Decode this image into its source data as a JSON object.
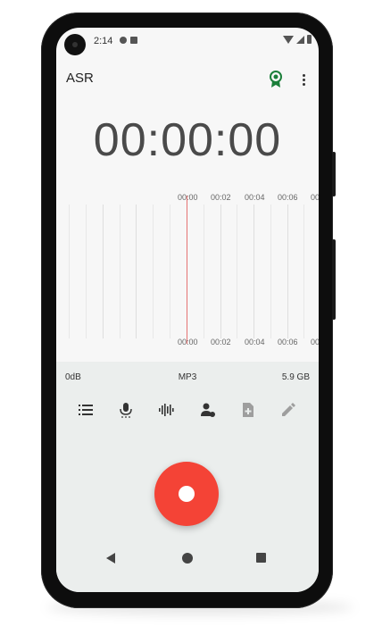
{
  "status_bar": {
    "time": "2:14",
    "icons": [
      "play-protect-icon",
      "sd-card-icon",
      "wifi-icon",
      "signal-icon",
      "battery-icon"
    ]
  },
  "app_bar": {
    "title": "ASR",
    "actions": [
      "award-icon",
      "more-vert-icon"
    ]
  },
  "timer": "00:00:00",
  "waveform": {
    "top_ticks": [
      "00:00",
      "00:02",
      "00:04",
      "00:06",
      "00:0"
    ],
    "bottom_ticks": [
      "00:00",
      "00:02",
      "00:04",
      "00:06",
      "00:0"
    ]
  },
  "info": {
    "level": "0dB",
    "format": "MP3",
    "storage": "5.9 GB"
  },
  "toolbar": [
    "list-icon",
    "mic-icon",
    "waveform-icon",
    "speaker-settings-icon",
    "add-file-icon",
    "edit-icon"
  ],
  "colors": {
    "record": "#f44336",
    "award": "#1b7f3a",
    "cursor": "#e57373"
  }
}
